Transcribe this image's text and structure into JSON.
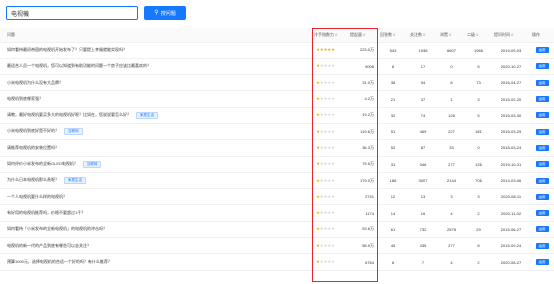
{
  "search": {
    "value": "电视機",
    "button_label": "搜问题"
  },
  "icons": {
    "search": "search-icon",
    "star": "star-icon",
    "sort": "sort-icon"
  },
  "colors": {
    "primary": "#1677ff",
    "star": "#f7b500",
    "highlight": "#e8252b"
  },
  "table": {
    "headers": {
      "question": "问题",
      "stars": "冷手指数力",
      "views": "提起量",
      "answers": "回答数",
      "followers": "关注数",
      "likes": "浏覽",
      "level2": "二级",
      "date": "提问时间",
      "action": "操作"
    },
    "rows": [
      {
        "question": "如何看待最初帝国的电视机开始发布了？只要提上幸福就能实现吗？",
        "tag": "",
        "stars": 5,
        "views": "223.0万",
        "answers": "543",
        "followers": "1936",
        "likes": "6607",
        "level2": "1966",
        "date": "2019-09-03",
        "action": "运用"
      },
      {
        "question": "最适合人员一个电视机，您可以知道到有助功能的问题一个房子应该比最喜欢的？",
        "tag": "",
        "stars": 1,
        "views": "9006",
        "answers": "8",
        "followers": "17",
        "likes": "0",
        "level2": "5",
        "date": "2020-10-27",
        "action": "运用"
      },
      {
        "question": "小米电视机为什么没有大品牌？",
        "tag": "",
        "stars": 1,
        "views": "31.0万",
        "answers": "38",
        "followers": "94",
        "likes": "8",
        "level2": "73",
        "date": "2016-04-27",
        "action": "运用"
      },
      {
        "question": "电视机到底哪家强？",
        "tag": "",
        "stars": 1,
        "views": "4.2万",
        "answers": "21",
        "followers": "37",
        "likes": "1",
        "level2": "3",
        "date": "2015-02-20",
        "action": "运用"
      },
      {
        "question": "请教，最好电视机要买多大的电视机好呢？比如在，您说说要怎么好？",
        "tag": "家居生活",
        "stars": 1,
        "views": "19.2万",
        "answers": "32",
        "followers": "74",
        "likes": "126",
        "level2": "5",
        "date": "2016-03-30",
        "action": "运用"
      },
      {
        "question": "小米电视机到底好是不好的？",
        "tag": "互联网",
        "stars": 1,
        "views": "119.6万",
        "answers": "51",
        "followers": "469",
        "likes": "227",
        "level2": "181",
        "date": "2016-03-29",
        "action": "运用"
      },
      {
        "question": "请推荐电视机的安装位置吗？",
        "tag": "",
        "stars": 1,
        "views": "36.3万",
        "answers": "52",
        "followers": "87",
        "likes": "33",
        "level2": "0",
        "date": "2018-03-24",
        "action": "运用"
      },
      {
        "question": "如何评价小米发布的全新OLED电视机？",
        "tag": "互联网",
        "stars": 1,
        "views": "79.5万",
        "answers": "31",
        "followers": "346",
        "likes": "277",
        "level2": "126",
        "date": "2019-10-31",
        "action": "运用"
      },
      {
        "question": "为什么日本电视机那么贵呢？",
        "tag": "家居生活",
        "stars": 1,
        "views": "179.0万",
        "answers": "186",
        "followers": "3007",
        "likes": "2144",
        "level2": "706",
        "date": "2014-03-06",
        "action": "运用"
      },
      {
        "question": "一个人电视机要什么样的电视机？",
        "tag": "",
        "stars": 1,
        "views": "2741",
        "answers": "12",
        "followers": "13",
        "likes": "3",
        "level2": "3",
        "date": "2020-08-11",
        "action": "运用"
      },
      {
        "question": "有好用的电视机推荐吗，价格不要超过1千？",
        "tag": "",
        "stars": 1,
        "views": "1174",
        "answers": "14",
        "followers": "16",
        "likes": "4",
        "level2": "2",
        "date": "2020-11-02",
        "action": "运用"
      },
      {
        "question": "如何看待「小米发布的全新电视机」的电视机的冲击吗？",
        "tag": "",
        "stars": 1,
        "views": "53.6万",
        "answers": "61",
        "followers": "732",
        "likes": "2578",
        "level2": "29",
        "date": "2015-06-27",
        "action": "运用"
      },
      {
        "question": "电视机的新一代的产品到底有哪些可以去关注？",
        "tag": "",
        "stars": 1,
        "views": "58.9万",
        "answers": "45",
        "followers": "435",
        "likes": "277",
        "level2": "8",
        "date": "2015-09-24",
        "action": "运用"
      },
      {
        "question": "预算1000元，选择电视机的合适一个好的吗？有什么推荐？",
        "tag": "",
        "stars": 1,
        "views": "6764",
        "answers": "6",
        "followers": "7",
        "likes": "4",
        "level2": "2",
        "date": "2020-08-27",
        "action": "运用"
      }
    ]
  }
}
